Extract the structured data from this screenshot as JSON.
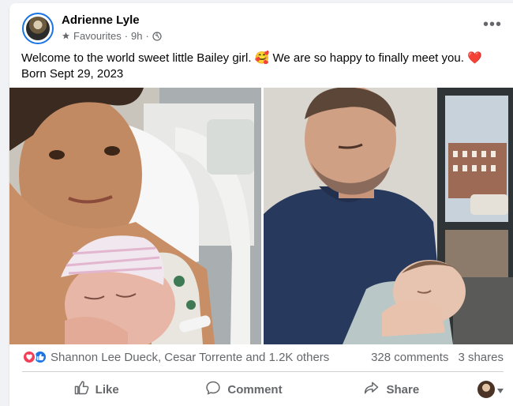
{
  "post": {
    "author": "Adrienne Lyle",
    "audience": "Favourites",
    "separator": "·",
    "time": "9h",
    "line1": "Welcome to the world sweet little Bailey girl. 🥰 We are so happy to finally meet you. ❤️",
    "line2": "Born Sept 29, 2023"
  },
  "stats": {
    "reactors": "Shannon Lee Dueck, Cesar Torrente and 1.2K others",
    "comments": "328 comments",
    "shares": "3 shares"
  },
  "actions": {
    "like": "Like",
    "comment": "Comment",
    "share": "Share"
  },
  "icons": {
    "more": "more-options-icon",
    "audience": "star-icon",
    "privacy": "globe-icon",
    "love": "love-reaction-icon",
    "like_reaction": "like-reaction-icon",
    "like": "thumbs-up-icon",
    "comment": "comment-bubble-icon",
    "share": "share-arrow-icon",
    "dropdown": "caret-down-icon"
  },
  "colors": {
    "accent": "#1b74e4",
    "love": "#f33e58",
    "secondary_text": "#65676b"
  }
}
